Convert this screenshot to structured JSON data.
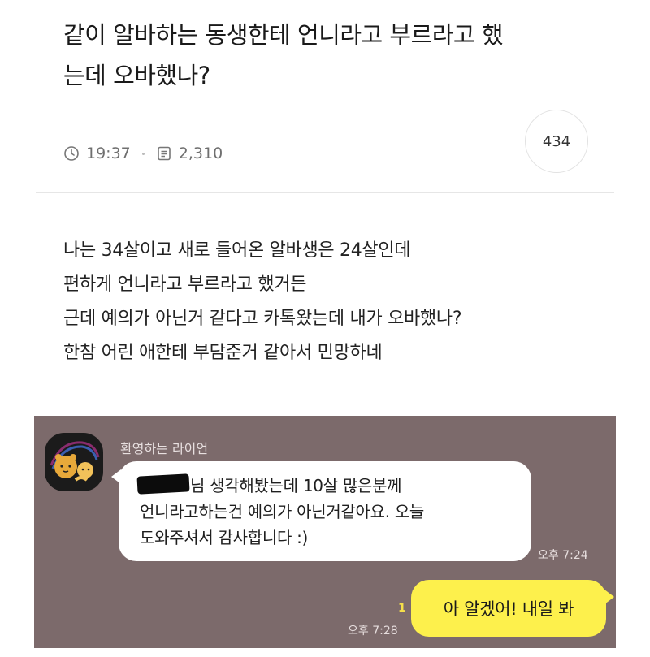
{
  "post": {
    "title_line1": "같이 알바하는 동생한테 언니라고 부르라고 했",
    "title_line2": "는데 오바했나?",
    "time": "19:37",
    "views": "2,310",
    "comment_count": "434",
    "body_lines": [
      "나는 34살이고 새로 들어온 알바생은 24살인데",
      "편하게 언니라고 부르라고 했거든",
      "근데 예의가 아닌거 같다고 카톡왔는데 내가 오바했나?",
      "한참 어린 애한테 부담준거 같아서 민망하네"
    ]
  },
  "chat": {
    "sender_name": "환영하는 라이언",
    "incoming_lines": [
      "님 생각해봤는데 10살 많은분께",
      "언니라고하는건 예의가 아닌거같아요. 오늘",
      "도와주셔서 감사합니다 :)"
    ],
    "incoming_time": "오후 7:24",
    "outgoing_text": "아 알겠어! 내일 봐",
    "outgoing_unread": "1",
    "outgoing_time": "오후 7:28",
    "colors": {
      "chat_background": "#7c6a6b",
      "incoming_bubble": "#ffffff",
      "outgoing_bubble": "#fdf04c"
    }
  }
}
